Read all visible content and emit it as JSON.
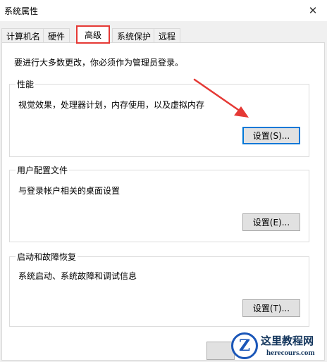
{
  "window": {
    "title": "系统属性"
  },
  "tabs": [
    {
      "label": "计算机名"
    },
    {
      "label": "硬件"
    },
    {
      "label": "高级",
      "selected": true
    },
    {
      "label": "系统保护"
    },
    {
      "label": "远程"
    }
  ],
  "notice": "要进行大多数更改，你必须作为管理员登录。",
  "groups": {
    "performance": {
      "title": "性能",
      "description": "视觉效果，处理器计划，内存使用，以及虚拟内存",
      "button": "设置(S)..."
    },
    "user_profiles": {
      "title": "用户配置文件",
      "description": "与登录帐户相关的桌面设置",
      "button": "设置(E)..."
    },
    "startup_recovery": {
      "title": "启动和故障恢复",
      "description": "系统启动、系统故障和调试信息",
      "button": "设置(T)..."
    }
  },
  "annotation": {
    "highlight_color": "#e53935"
  },
  "watermark": {
    "logo_letter": "Z",
    "name": "这里教程网",
    "url": "herecours.com"
  },
  "icons": {
    "close": "close-icon",
    "logo": "zh-logo-icon"
  }
}
